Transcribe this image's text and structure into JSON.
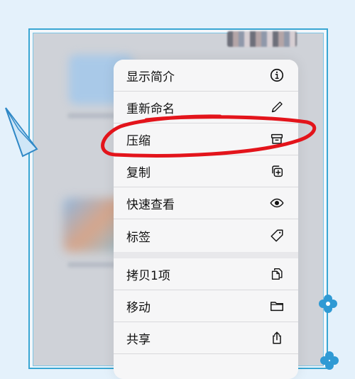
{
  "menu": {
    "items": [
      {
        "label": "显示简介",
        "icon": "info-circle-icon"
      },
      {
        "label": "重新命名",
        "icon": "pencil-icon"
      },
      {
        "label": "压缩",
        "icon": "archive-box-icon"
      },
      {
        "label": "复制",
        "icon": "duplicate-plus-icon"
      },
      {
        "label": "快速查看",
        "icon": "eye-icon"
      },
      {
        "label": "标签",
        "icon": "tag-icon"
      },
      {
        "label": "拷贝1项",
        "icon": "copy-documents-icon"
      },
      {
        "label": "移动",
        "icon": "folder-icon"
      },
      {
        "label": "共享",
        "icon": "share-icon"
      }
    ]
  },
  "colors": {
    "page_background": "#e4f1fb",
    "frame_border": "#39a6d3",
    "annotation_red": "#e3141b",
    "menu_background": "#f6f6f7"
  }
}
